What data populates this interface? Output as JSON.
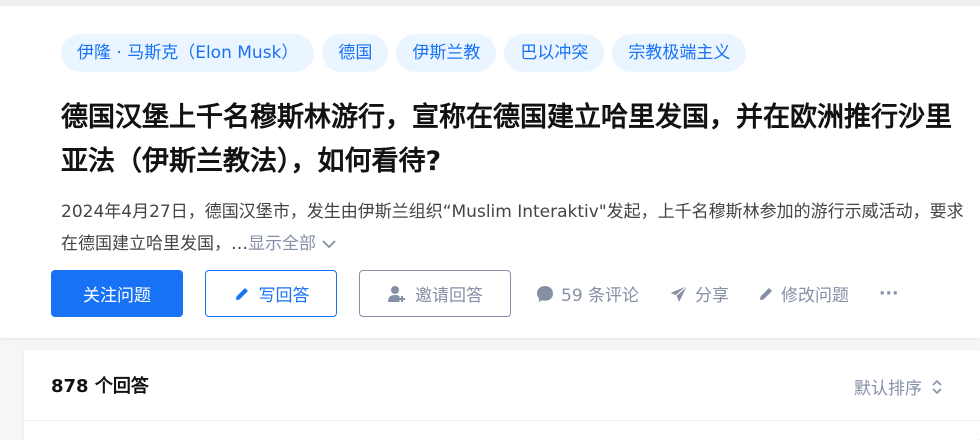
{
  "topics": [
    {
      "label": "伊隆 · 马斯克（Elon Musk）"
    },
    {
      "label": "德国"
    },
    {
      "label": "伊斯兰教"
    },
    {
      "label": "巴以冲突"
    },
    {
      "label": "宗教极端主义"
    }
  ],
  "question": {
    "title": "德国汉堡上千名穆斯林游行，宣称在德国建立哈里发国，并在欧洲推行沙里亚法（伊斯兰教法），如何看待?",
    "excerpt": "2024年4月27日，德国汉堡市，发生由伊斯兰组织“Muslim Interaktiv\"发起，上千名穆斯林参加的游行示威活动，要求在德国建立哈里发国，…",
    "show_all": "显示全部"
  },
  "actions": {
    "follow": "关注问题",
    "write_answer": "写回答",
    "invite": "邀请回答",
    "comments": "59 条评论",
    "share": "分享",
    "edit": "修改问题",
    "more": "···"
  },
  "answers": {
    "count_label": "878 个回答",
    "sort_label": "默认排序"
  },
  "colors": {
    "accent": "#1772f6",
    "tag_bg": "#ebf5ff",
    "muted": "#8590a6"
  }
}
